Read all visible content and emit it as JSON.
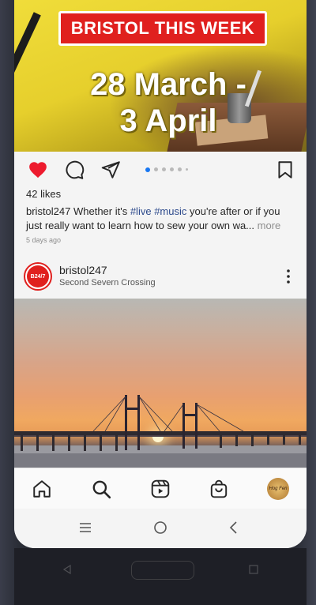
{
  "hero": {
    "title": "BRISTOL THIS WEEK",
    "date_line1": "28 March -",
    "date_line2": "3 April"
  },
  "actions": {
    "like_icon": "heart-filled-icon",
    "comment_icon": "comment-icon",
    "share_icon": "send-icon",
    "save_icon": "bookmark-icon",
    "carousel_count": 6,
    "carousel_active": 1
  },
  "post1": {
    "likes": "42 likes",
    "username": "bristol247",
    "caption_pre": " Whether it's ",
    "tag1": "#live",
    "tag2": "#music",
    "caption_post": " you're after or if you just really want to learn how to sew your own wa...",
    "more": " more",
    "timestamp": "5 days ago"
  },
  "post2": {
    "avatar_text": "B24/7",
    "username": "bristol247",
    "location": "Second Severn Crossing"
  },
  "bottom_nav": {
    "items": [
      "home-icon",
      "search-icon",
      "reels-icon",
      "shop-icon",
      "profile-avatar"
    ],
    "avatar_text": "Hog Fen"
  },
  "system_nav": [
    "recents-icon",
    "home-circle-icon",
    "back-icon"
  ],
  "colors": {
    "like_red": "#ed1b2e",
    "brand_red": "#e0201e",
    "hashtag_blue": "#2d4a8c",
    "carousel_active": "#1877f2"
  }
}
